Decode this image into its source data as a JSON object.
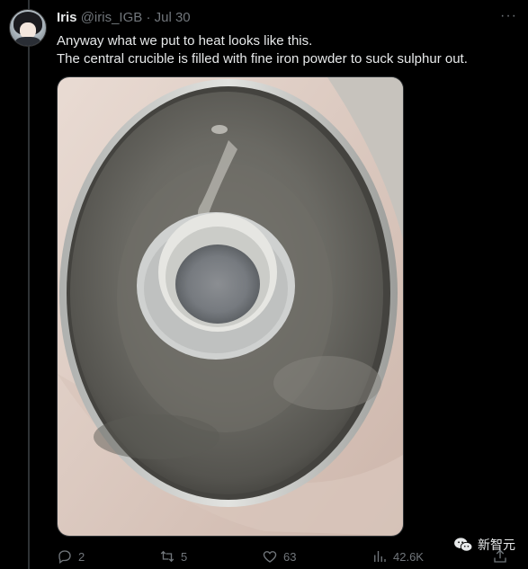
{
  "tweet": {
    "author_name": "Iris",
    "author_handle": "@iris_IGB",
    "separator": "·",
    "date": "Jul 30",
    "more_label": "···",
    "text_lines": [
      "Anyway what we put to heat looks like this.",
      "The central crucible is filled with fine iron powder to suck sulphur out."
    ],
    "media": {
      "icon": "photo-crucible-in-tube"
    }
  },
  "actions": {
    "reply_count": "2",
    "retweet_count": "5",
    "like_count": "63",
    "views_count": "42.6K"
  },
  "watermark": {
    "text": "新智元",
    "icon": "wechat-icon"
  },
  "colors": {
    "background": "#000000",
    "text": "#e7e9ea",
    "muted": "#71767b",
    "divider": "#2f3336"
  }
}
